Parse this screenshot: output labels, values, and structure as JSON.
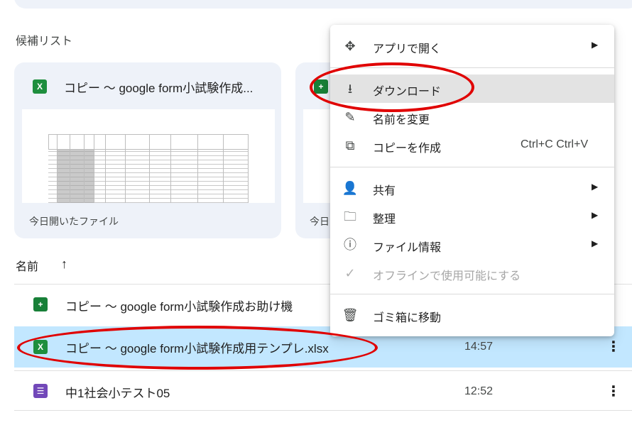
{
  "section_title": "候補リスト",
  "cards": [
    {
      "title": "コピー 〜 google form小試験作成...",
      "icon": "X",
      "subtitle": "今日開いたファイル"
    },
    {
      "title": "",
      "icon": "+",
      "subtitle": "今日"
    }
  ],
  "list": {
    "sort_label": "名前",
    "sort_arrow": "↑",
    "rows": [
      {
        "icon": "+",
        "name": "コピー 〜 google form小試験作成お助け機",
        "time": ""
      },
      {
        "icon": "X",
        "name": "コピー 〜 google form小試験作成用テンプレ.xlsx",
        "time": "14:57"
      },
      {
        "icon": "☰",
        "name": "中1社会小テスト05",
        "time": "12:52"
      }
    ],
    "more_icon": "⋮"
  },
  "context_menu": {
    "items": [
      {
        "icon": "✥",
        "label": "アプリで開く",
        "submenu": true
      },
      {
        "icon": "⭳",
        "label": "ダウンロード",
        "highlighted": true
      },
      {
        "icon": "✎",
        "label": "名前を変更"
      },
      {
        "icon": "⧉",
        "label": "コピーを作成",
        "shortcut": "Ctrl+C Ctrl+V"
      },
      {
        "icon": "👤",
        "label": "共有",
        "submenu": true
      },
      {
        "icon": "🗀",
        "label": "整理",
        "submenu": true
      },
      {
        "icon": "ⓘ",
        "label": "ファイル情報",
        "submenu": true
      },
      {
        "icon": "✓",
        "label": "オフラインで使用可能にする",
        "disabled": true
      },
      {
        "icon": "🗑",
        "label": "ゴミ箱に移動"
      }
    ],
    "submenu_arrow": "▶"
  },
  "colors": {
    "excel": "#1e8e3e",
    "sheets": "#188038",
    "forms": "#7248b9",
    "selected_row": "#c2e7ff",
    "annotation": "#e00000"
  }
}
